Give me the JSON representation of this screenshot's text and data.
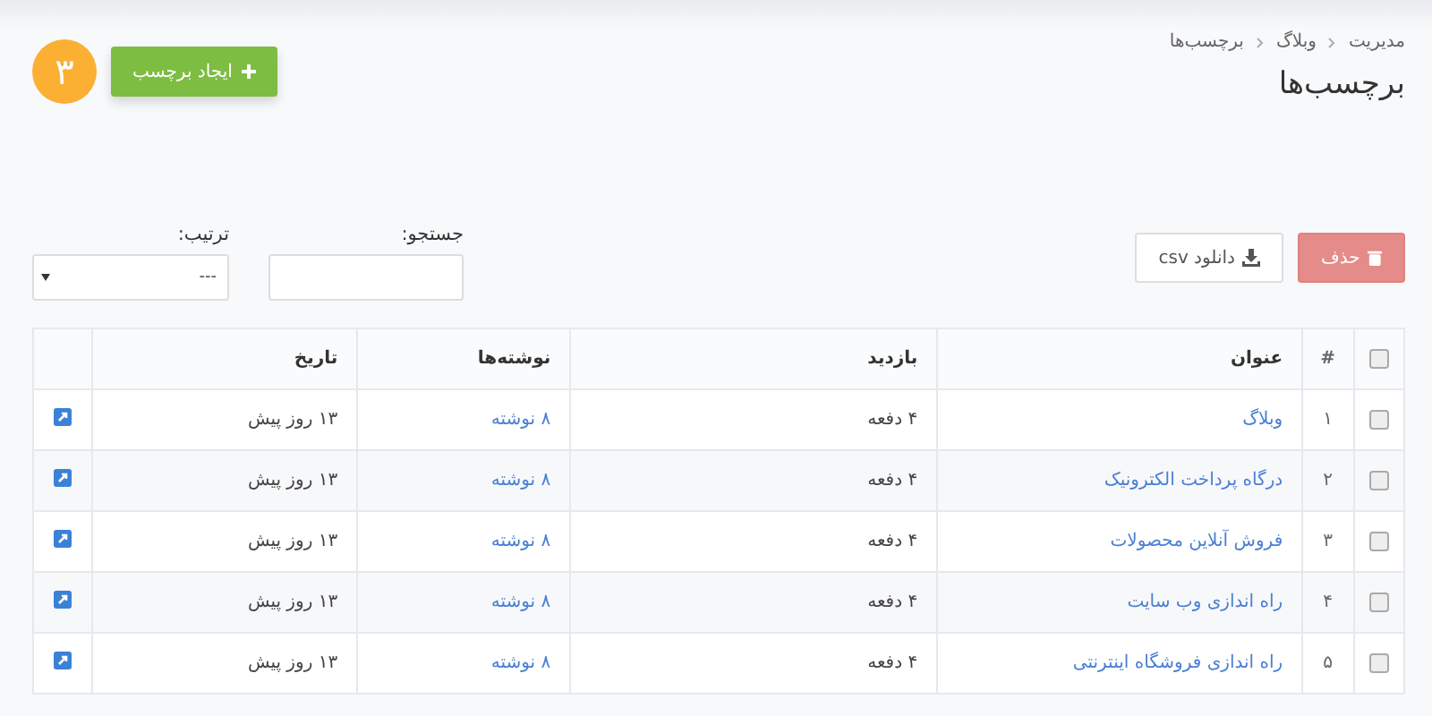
{
  "breadcrumb": [
    "مدیریت",
    "وبلاگ",
    "برچسب‌ها"
  ],
  "page_title": "برچسب‌ها",
  "create_button": {
    "label": "ایجاد برچسب"
  },
  "step_badge": "۳",
  "delete_button": {
    "label": "حذف"
  },
  "download_button": {
    "label": "دانلود csv"
  },
  "search": {
    "label": "جستجو:"
  },
  "sort": {
    "label": "ترتیب:",
    "value": "---"
  },
  "table": {
    "select_all_checked": false,
    "columns": [
      "#",
      "عنوان",
      "بازدید",
      "نوشته‌ها",
      "تاریخ"
    ],
    "rows": [
      {
        "checked": false,
        "index": "۱",
        "title": "وبلاگ",
        "visits": "۴ دفعه",
        "posts": "۸ نوشته",
        "date": "۱۳ روز پیش"
      },
      {
        "checked": false,
        "index": "۲",
        "title": "درگاه پرداخت الکترونیک",
        "visits": "۴ دفعه",
        "posts": "۸ نوشته",
        "date": "۱۳ روز پیش"
      },
      {
        "checked": false,
        "index": "۳",
        "title": "فروش آنلاین محصولات",
        "visits": "۴ دفعه",
        "posts": "۸ نوشته",
        "date": "۱۳ روز پیش"
      },
      {
        "checked": false,
        "index": "۴",
        "title": "راه اندازی وب سایت",
        "visits": "۴ دفعه",
        "posts": "۸ نوشته",
        "date": "۱۳ روز پیش"
      },
      {
        "checked": false,
        "index": "۵",
        "title": "راه اندازی فروشگاه اینترنتی",
        "visits": "۴ دفعه",
        "posts": "۸ نوشته",
        "date": "۱۳ روز پیش"
      }
    ]
  }
}
